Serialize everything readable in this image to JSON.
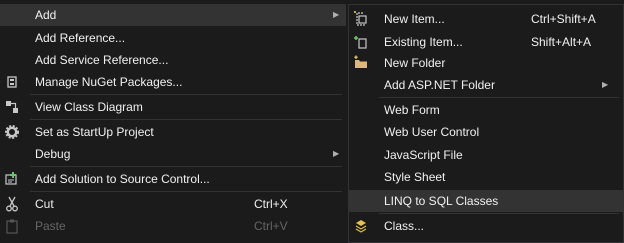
{
  "main_menu": {
    "items": [
      {
        "label": "Add",
        "icon": "",
        "shortcut": "",
        "submenu": true,
        "highlighted": true,
        "disabled": false
      },
      {
        "label": "Add Reference...",
        "icon": "",
        "shortcut": "",
        "submenu": false,
        "highlighted": false,
        "disabled": false
      },
      {
        "label": "Add Service Reference...",
        "icon": "",
        "shortcut": "",
        "submenu": false,
        "highlighted": false,
        "disabled": false
      },
      {
        "label": "Manage NuGet Packages...",
        "icon": "nuget-icon",
        "shortcut": "",
        "submenu": false,
        "highlighted": false,
        "disabled": false
      },
      {
        "label": "View Class Diagram",
        "icon": "class-diagram-icon",
        "shortcut": "",
        "submenu": false,
        "highlighted": false,
        "disabled": false
      },
      {
        "label": "Set as StartUp Project",
        "icon": "gear-icon",
        "shortcut": "",
        "submenu": false,
        "highlighted": false,
        "disabled": false
      },
      {
        "label": "Debug",
        "icon": "",
        "shortcut": "",
        "submenu": true,
        "highlighted": false,
        "disabled": false
      },
      {
        "label": "Add Solution to Source Control...",
        "icon": "source-control-icon",
        "shortcut": "",
        "submenu": false,
        "highlighted": false,
        "disabled": false
      },
      {
        "label": "Cut",
        "icon": "scissors-icon",
        "shortcut": "Ctrl+X",
        "submenu": false,
        "highlighted": false,
        "disabled": false
      },
      {
        "label": "Paste",
        "icon": "paste-icon",
        "shortcut": "Ctrl+V",
        "submenu": false,
        "highlighted": false,
        "disabled": true
      }
    ]
  },
  "submenu": {
    "items": [
      {
        "label": "New Item...",
        "icon": "new-item-icon",
        "shortcut": "Ctrl+Shift+A",
        "submenu": false,
        "highlighted": false
      },
      {
        "label": "Existing Item...",
        "icon": "existing-item-icon",
        "shortcut": "Shift+Alt+A",
        "submenu": false,
        "highlighted": false
      },
      {
        "label": "New Folder",
        "icon": "new-folder-icon",
        "shortcut": "",
        "submenu": false,
        "highlighted": false
      },
      {
        "label": "Add ASP.NET Folder",
        "icon": "",
        "shortcut": "",
        "submenu": true,
        "highlighted": false
      },
      {
        "label": "Web Form",
        "icon": "",
        "shortcut": "",
        "submenu": false,
        "highlighted": false
      },
      {
        "label": "Web User Control",
        "icon": "",
        "shortcut": "",
        "submenu": false,
        "highlighted": false
      },
      {
        "label": "JavaScript File",
        "icon": "",
        "shortcut": "",
        "submenu": false,
        "highlighted": false
      },
      {
        "label": "Style Sheet",
        "icon": "",
        "shortcut": "",
        "submenu": false,
        "highlighted": false
      },
      {
        "label": "LINQ to SQL Classes",
        "icon": "",
        "shortcut": "",
        "submenu": false,
        "highlighted": true
      },
      {
        "label": "Class...",
        "icon": "class-icon",
        "shortcut": "",
        "submenu": false,
        "highlighted": false
      }
    ]
  },
  "colors": {
    "background": "#1b1b1c",
    "highlight": "#333334",
    "text": "#f1f1f1",
    "disabled_text": "#656565",
    "separator": "#333337"
  }
}
